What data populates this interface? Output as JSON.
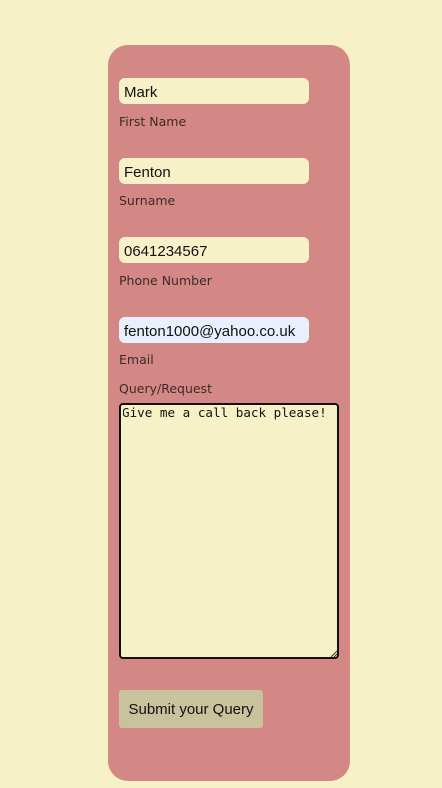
{
  "colors": {
    "page_background": "#f7f1c7",
    "card_background": "#d38885",
    "field_background": "#f7f1c7",
    "autofill_background": "#e8f0fe",
    "button_background": "#c8c29d"
  },
  "form": {
    "first_name": {
      "value": "Mark",
      "label": "First Name"
    },
    "surname": {
      "value": "Fenton",
      "label": "Surname"
    },
    "phone": {
      "value": "0641234567",
      "label": "Phone Number"
    },
    "email": {
      "value": "fenton1000@yahoo.co.uk",
      "label": "Email"
    },
    "query": {
      "label": "Query/Request",
      "value": "Give me a call back please!"
    },
    "submit_label": "Submit your Query"
  }
}
